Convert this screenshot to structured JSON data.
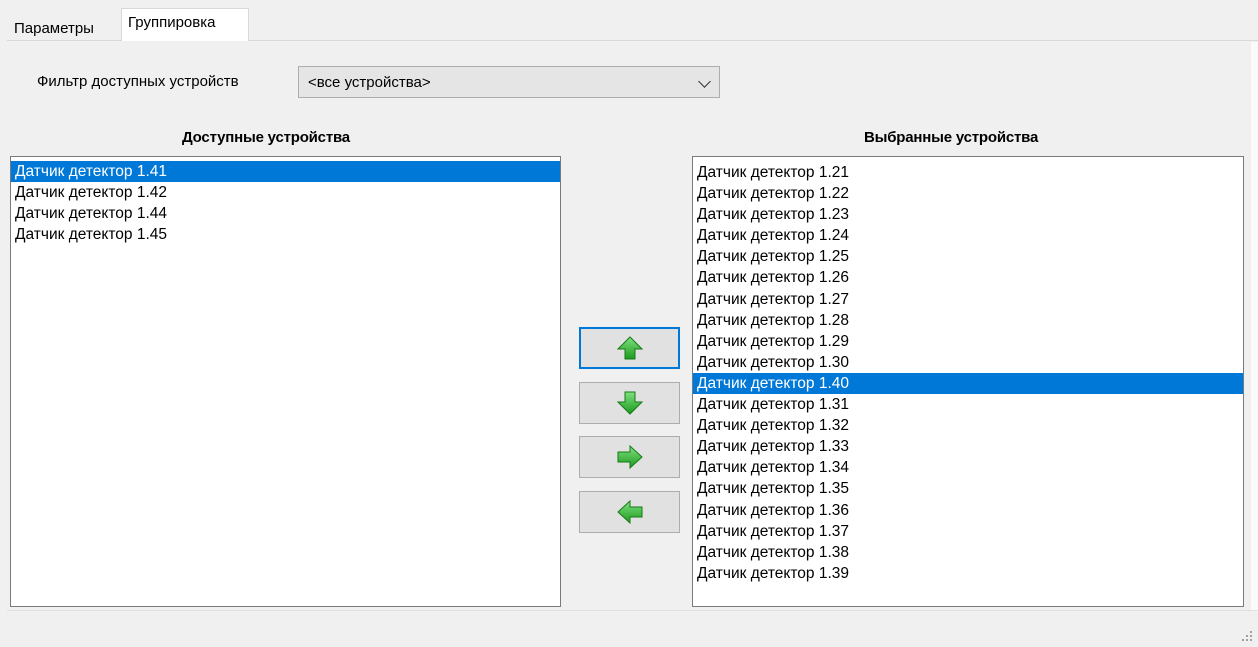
{
  "tabs": [
    {
      "label": "Параметры",
      "active": false
    },
    {
      "label": "Группировка",
      "active": true
    }
  ],
  "filter": {
    "label": "Фильтр доступных устройств",
    "selected": "<все устройства>"
  },
  "available": {
    "title": "Доступные устройства",
    "items": [
      "Датчик детектор 1.41",
      "Датчик детектор 1.42",
      "Датчик детектор 1.44",
      "Датчик детектор 1.45"
    ],
    "selected_index": 0
  },
  "selected_devices": {
    "title": "Выбранные устройства",
    "items": [
      "Датчик детектор 1.21",
      "Датчик детектор 1.22",
      "Датчик детектор 1.23",
      "Датчик детектор 1.24",
      "Датчик детектор 1.25",
      "Датчик детектор 1.26",
      "Датчик детектор 1.27",
      "Датчик детектор 1.28",
      "Датчик детектор 1.29",
      "Датчик детектор 1.30",
      "Датчик детектор 1.40",
      "Датчик детектор 1.31",
      "Датчик детектор 1.32",
      "Датчик детектор 1.33",
      "Датчик детектор 1.34",
      "Датчик детектор 1.35",
      "Датчик детектор 1.36",
      "Датчик детектор 1.37",
      "Датчик детектор 1.38",
      "Датчик детектор 1.39"
    ],
    "selected_index": 10
  },
  "buttons": {
    "move_up_icon": "arrow-up-icon",
    "move_down_icon": "arrow-down-icon",
    "add_icon": "arrow-right-icon",
    "remove_icon": "arrow-left-icon"
  },
  "colors": {
    "selection": "#0078d7",
    "arrow_green": "#2fb52f"
  }
}
